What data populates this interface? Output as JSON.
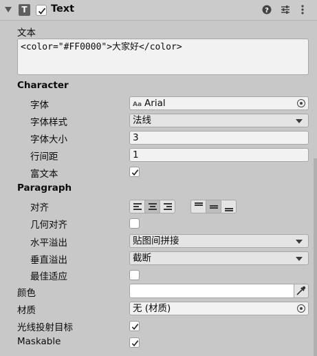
{
  "header": {
    "component_icon_letter": "T",
    "title": "Text",
    "enabled": true
  },
  "text_section": {
    "label": "文本",
    "value": "<color=\"#FF0000\">大家好</color>"
  },
  "character": {
    "heading": "Character",
    "font_label": "字体",
    "font_icon_text": "Aa",
    "font_value": "Arial",
    "font_style_label": "字体样式",
    "font_style_value": "法线",
    "font_size_label": "字体大小",
    "font_size_value": "3",
    "line_spacing_label": "行间距",
    "line_spacing_value": "1",
    "rich_text_label": "富文本",
    "rich_text_checked": true
  },
  "paragraph": {
    "heading": "Paragraph",
    "alignment_label": "对齐",
    "horizontal_alignment_selected": "center",
    "vertical_alignment_selected": "middle",
    "align_by_geometry_label": "几何对齐",
    "align_by_geometry_checked": false,
    "horizontal_overflow_label": "水平溢出",
    "horizontal_overflow_value": "贴图间拼接",
    "vertical_overflow_label": "垂直溢出",
    "vertical_overflow_value": "截断",
    "best_fit_label": "最佳适应",
    "best_fit_checked": false
  },
  "color": {
    "label": "颜色",
    "value": "#FFFFFF"
  },
  "material": {
    "label": "材质",
    "value": "无 (材质)"
  },
  "raycast": {
    "label": "光线投射目标",
    "checked": true
  },
  "maskable": {
    "label": "Maskable",
    "checked": true
  },
  "icons": {
    "foldout": "foldout-arrow-icon",
    "help": "help-icon",
    "presets": "presets-icon",
    "more": "more-icon",
    "object_picker": "object-picker-icon",
    "eyedropper": "eyedropper-icon",
    "checkmark": "checkmark-icon"
  }
}
